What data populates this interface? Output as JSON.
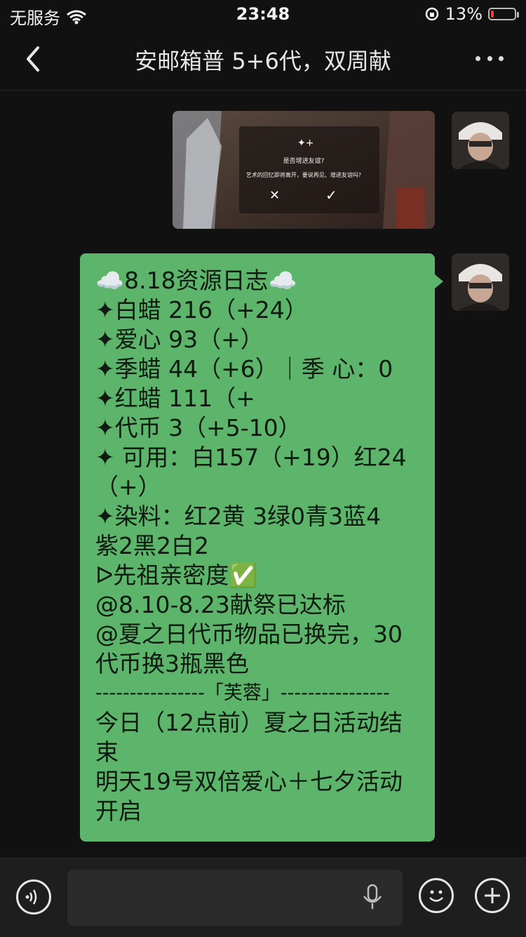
{
  "status": {
    "carrier": "无服务",
    "time": "23:48",
    "battery_percent": "13%",
    "battery_level": 0.13
  },
  "nav": {
    "title": "安邮箱普 5+6代，双周献"
  },
  "image_dialog": {
    "title": "是否增进友谊?",
    "subtitle": "艺术的回忆即将离开，要说再见、增进友谊吗?",
    "reject": "✕",
    "accept": "✓"
  },
  "message": {
    "lines": [
      "☁️8.18资源日志☁️",
      "✦白蜡 216（+24）",
      "✦爱心 93（+）",
      "✦季蜡 44（+6）｜季 心：0",
      "✦红蜡 111（+",
      "✦代币 3（+5-10）",
      "✦ 可用：白157（+19）红24",
      "（+）",
      "✦染料：红2黄 3绿0青3蓝4",
      "紫2黑2白2",
      "ᐅ先祖亲密度✅",
      "@8.10-8.23献祭已达标",
      "@夏之日代币物品已换完，30",
      "代币换3瓶黑色",
      "----------------「芙蓉」----------------",
      "今日（12点前）夏之日活动结",
      "束",
      "明天19号双倍爱心＋七夕活动",
      "开启"
    ]
  },
  "colors": {
    "bubble": "#5db56b",
    "background": "#111111",
    "battery_low": "#ff3b30"
  },
  "icons": [
    "back-chevron-icon",
    "more-icon",
    "voice-icon",
    "microphone-icon",
    "emoji-icon",
    "plus-icon",
    "wifi-icon",
    "orientation-lock-icon",
    "battery-icon"
  ]
}
